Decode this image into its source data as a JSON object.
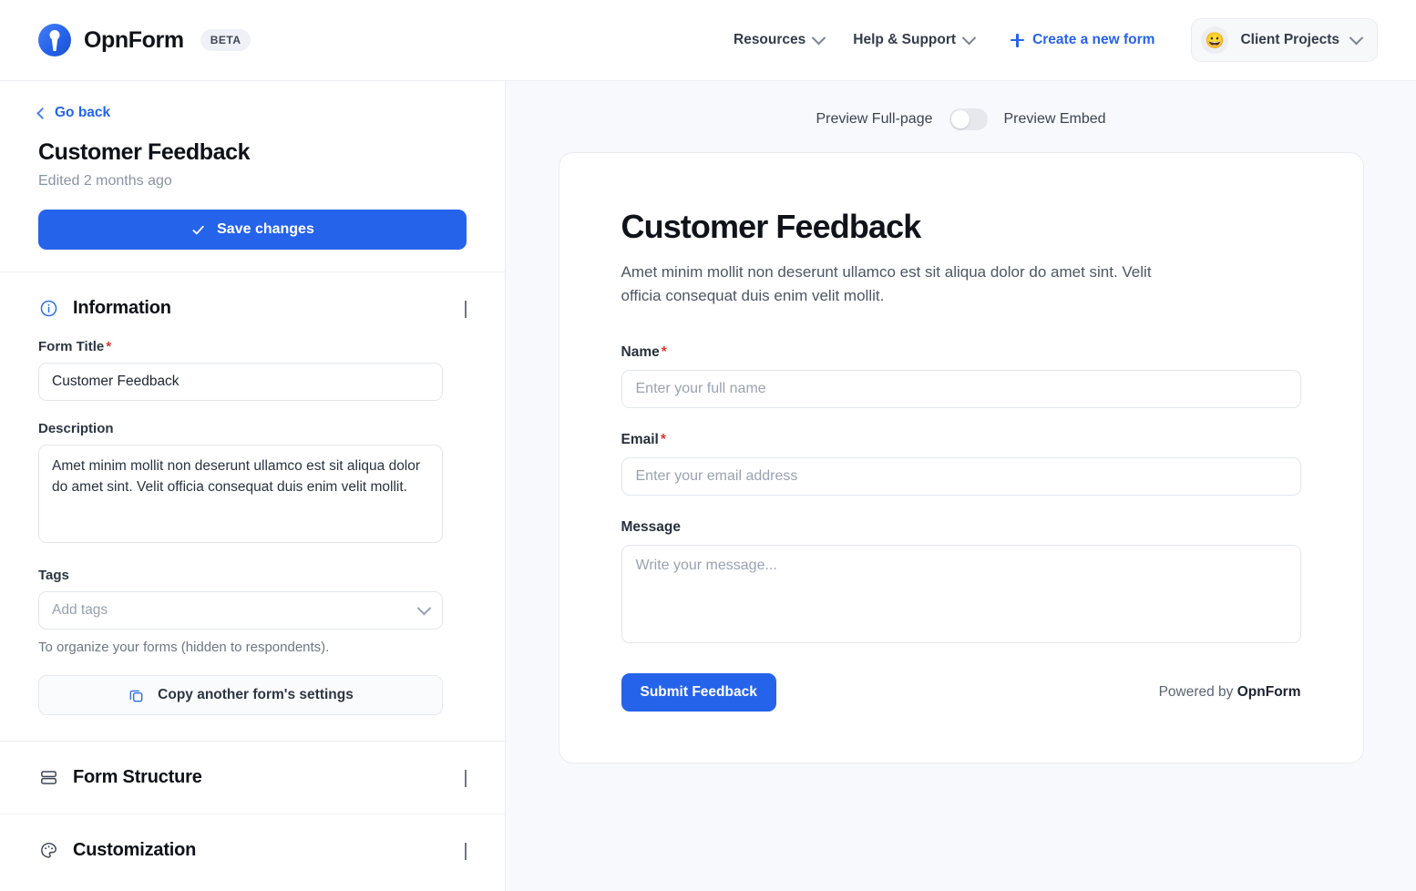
{
  "topnav": {
    "brand_name": "OpnForm",
    "beta_label": "BETA",
    "logo_icon": "opnform-logo-icon",
    "items": [
      {
        "label": "Resources",
        "icon": "chevron-down-icon"
      },
      {
        "label": "Help & Support",
        "icon": "chevron-down-icon"
      }
    ],
    "create_label": "Create a new form",
    "create_icon": "plus-icon",
    "workspace": {
      "avatar_emoji": "😀",
      "name": "Client Projects",
      "icon": "chevron-down-icon"
    }
  },
  "sidebar": {
    "go_back": "Go back",
    "go_back_icon": "chevron-left-icon",
    "form_title": "Customer Feedback",
    "edited": "Edited 2 months ago",
    "save_label": "Save changes",
    "save_icon": "check-icon",
    "sections": [
      {
        "id": "information",
        "title": "Information",
        "icon": "info-circle-icon",
        "expanded": true,
        "toggle_icon": "chevron-up-icon"
      },
      {
        "id": "form-structure",
        "title": "Form Structure",
        "icon": "rows-icon",
        "expanded": false,
        "toggle_icon": "chevron-down-icon"
      },
      {
        "id": "customization",
        "title": "Customization",
        "icon": "palette-icon",
        "expanded": false,
        "toggle_icon": "chevron-down-icon"
      }
    ],
    "information": {
      "form_title_label": "Form Title",
      "form_title_required": "*",
      "form_title_value": "Customer Feedback",
      "description_label": "Description",
      "description_value": "Amet minim mollit non deserunt ullamco est sit aliqua dolor do amet sint. Velit officia consequat duis enim velit mollit.",
      "tags_label": "Tags",
      "tags_placeholder": "Add tags",
      "tags_chevron_icon": "chevron-down-icon",
      "tags_helper": "To organize your forms (hidden to respondents).",
      "copy_settings_label": "Copy another form's settings",
      "copy_settings_icon": "copy-icon"
    }
  },
  "main": {
    "preview_toggle": {
      "left_label": "Preview Full-page",
      "right_label": "Preview Embed",
      "state": "off"
    },
    "form_preview": {
      "title": "Customer Feedback",
      "description": "Amet minim mollit non deserunt ullamco est sit aliqua dolor do amet sint. Velit officia consequat duis enim velit mollit.",
      "fields": [
        {
          "label": "Name",
          "required": "*",
          "placeholder": "Enter your full name",
          "type": "text"
        },
        {
          "label": "Email",
          "required": "*",
          "placeholder": "Enter your email address",
          "type": "text"
        },
        {
          "label": "Message",
          "required": "",
          "placeholder": "Write your message...",
          "type": "textarea"
        }
      ],
      "submit_label": "Submit Feedback",
      "powered_by_prefix": "Powered by ",
      "powered_by_brand": "OpnForm"
    }
  },
  "colors": {
    "accent_blue": "#2563eb",
    "required_red": "#e2362f",
    "panel_bg": "#f8f9fc",
    "border": "#eceef2"
  }
}
